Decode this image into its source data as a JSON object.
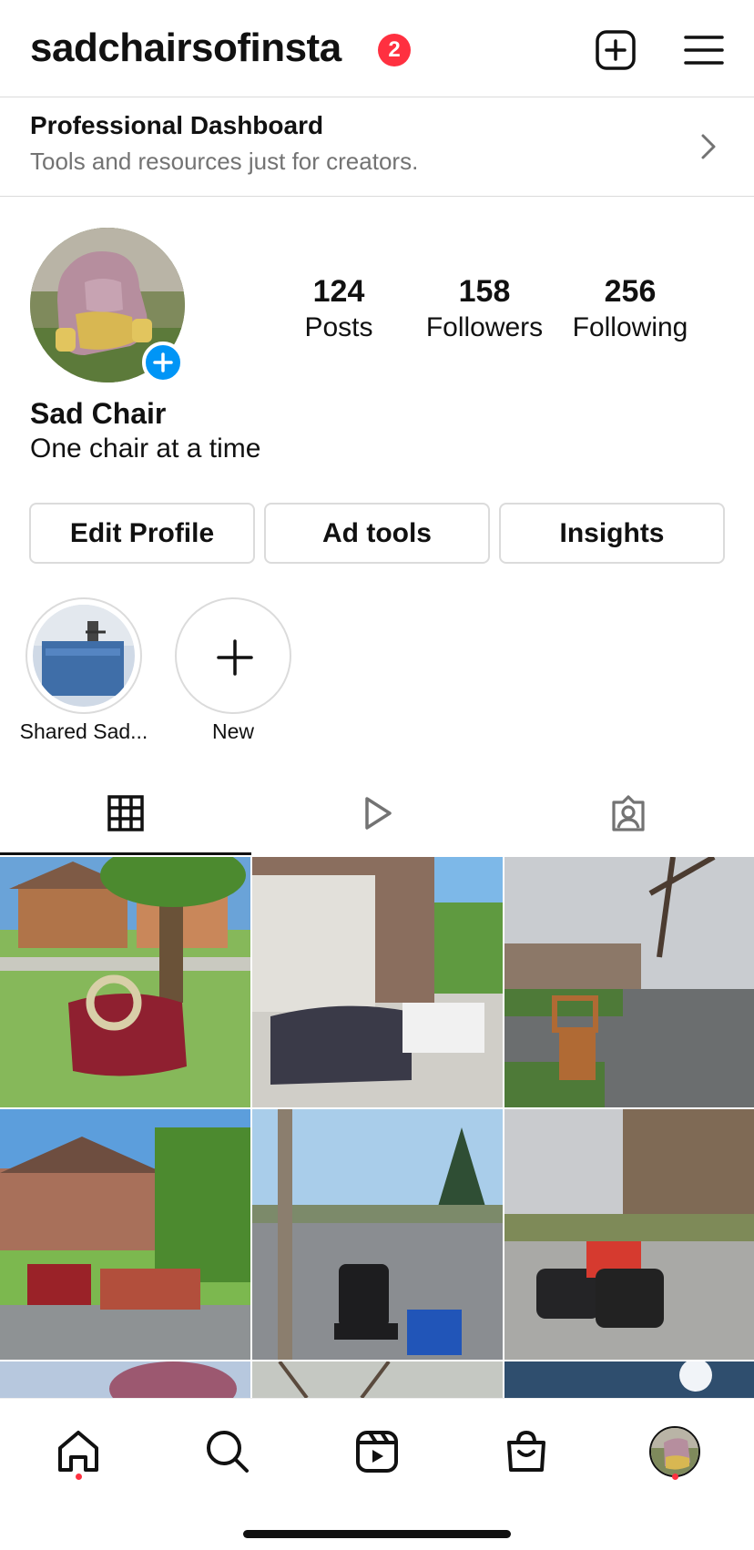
{
  "header": {
    "username": "sadchairsofinsta",
    "notification_count": "2"
  },
  "dashboard": {
    "title": "Professional Dashboard",
    "subtitle": "Tools and resources just for creators."
  },
  "profile": {
    "display_name": "Sad Chair",
    "bio": "One chair at a time",
    "stats": {
      "posts": {
        "value": "124",
        "label": "Posts"
      },
      "followers": {
        "value": "158",
        "label": "Followers"
      },
      "following": {
        "value": "256",
        "label": "Following"
      }
    }
  },
  "actions": {
    "edit_profile": "Edit Profile",
    "ad_tools": "Ad tools",
    "insights": "Insights"
  },
  "highlights": [
    {
      "label": "Shared Sad..."
    },
    {
      "label": "New"
    }
  ],
  "tabs": [
    {
      "name": "posts-grid",
      "icon": "grid-icon",
      "active": true
    },
    {
      "name": "reels",
      "icon": "play-icon",
      "active": false
    },
    {
      "name": "tagged",
      "icon": "tagged-person-icon",
      "active": false
    }
  ],
  "grid_posts": [
    {
      "description": "red-loveseat-on-lawn"
    },
    {
      "description": "sofa-and-mattress-by-garage"
    },
    {
      "description": "wooden-chair-on-rainy-street"
    },
    {
      "description": "two-red-sofas-on-lawn"
    },
    {
      "description": "office-chair-by-tree"
    },
    {
      "description": "two-office-chairs-for-sale"
    },
    {
      "description": "partial-row-1"
    },
    {
      "description": "partial-row-2"
    },
    {
      "description": "partial-row-3"
    }
  ],
  "bottom_nav": [
    {
      "name": "home",
      "icon": "home-icon",
      "has_dot": true
    },
    {
      "name": "search",
      "icon": "search-icon",
      "has_dot": false
    },
    {
      "name": "reels",
      "icon": "reels-icon",
      "has_dot": false
    },
    {
      "name": "shop",
      "icon": "shopping-bag-icon",
      "has_dot": false
    },
    {
      "name": "profile",
      "icon": "profile-avatar-icon",
      "has_dot": true
    }
  ],
  "colors": {
    "badge": "#ff3040",
    "accent_blue": "#0095f6",
    "border": "#dbdbdb",
    "muted_text": "#737373"
  }
}
